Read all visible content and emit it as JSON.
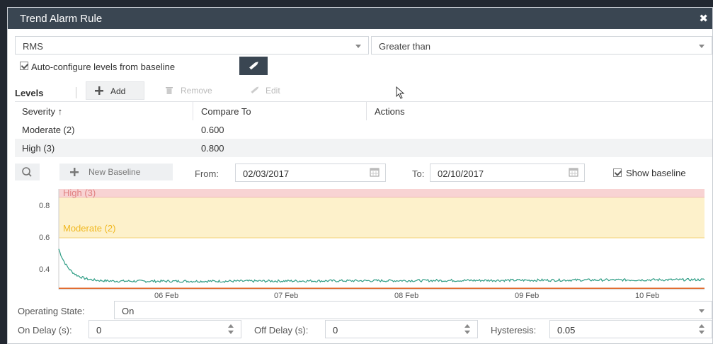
{
  "dialog": {
    "title": "Trend Alarm Rule",
    "close_icon": "close-icon"
  },
  "metric": {
    "value": "RMS"
  },
  "comparison": {
    "value": "Greater than"
  },
  "auto_configure": {
    "label": "Auto-configure levels from baseline",
    "checked": true
  },
  "levels_toolbar": {
    "title": "Levels",
    "add_label": "Add",
    "remove_label": "Remove",
    "edit_label": "Edit"
  },
  "levels_table": {
    "columns": [
      "Severity ↑",
      "Compare To",
      "Actions"
    ],
    "rows": [
      {
        "severity": "Moderate (2)",
        "compare_to": "0.600"
      },
      {
        "severity": "High (3)",
        "compare_to": "0.800"
      }
    ]
  },
  "baseline_bar": {
    "new_baseline_label": "New Baseline",
    "from_label": "From:",
    "from_value": "02/03/2017",
    "to_label": "To:",
    "to_value": "02/10/2017",
    "show_baseline_label": "Show baseline",
    "show_baseline_checked": true
  },
  "chart_data": {
    "type": "line",
    "y_ticks": [
      0.8,
      0.6,
      0.4
    ],
    "x_ticks": [
      "06 Feb",
      "07 Feb",
      "08 Feb",
      "09 Feb",
      "10 Feb"
    ],
    "bands": [
      {
        "name": "High (3)",
        "from": 0.8,
        "color": "#f8d0d0"
      },
      {
        "name": "Moderate (2)",
        "from": 0.6,
        "to": 0.8,
        "color": "#fdf0c6"
      }
    ],
    "threshold_line": 0.35,
    "series_color": "#2e9d85"
  },
  "bottom": {
    "operating_state_label": "Operating State:",
    "operating_state_value": "On",
    "on_delay_label": "On Delay (s):",
    "on_delay_value": "0",
    "off_delay_label": "Off Delay (s):",
    "off_delay_value": "0",
    "hysteresis_label": "Hysteresis:",
    "hysteresis_value": "0.05"
  }
}
